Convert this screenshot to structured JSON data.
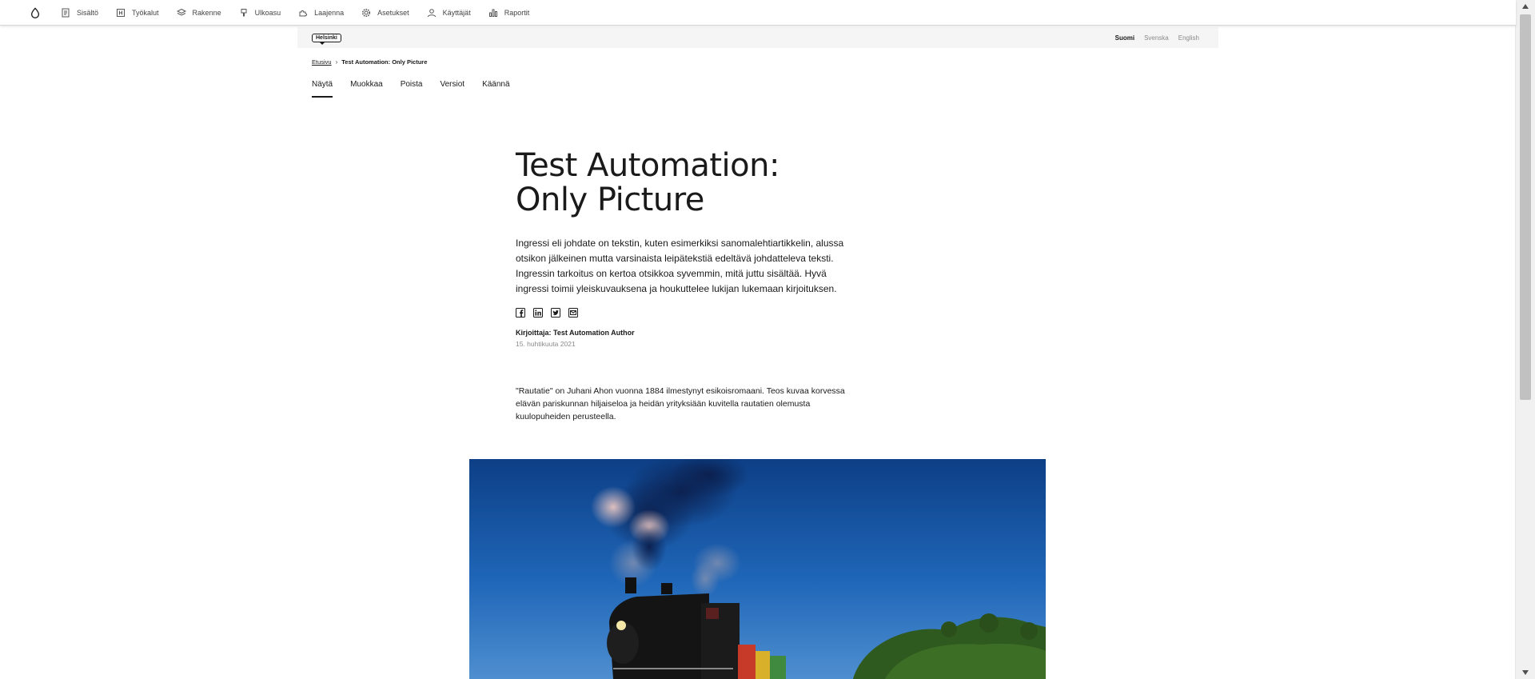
{
  "toolbar": {
    "home_icon": "drop-icon",
    "items": [
      {
        "label": "Sisältö",
        "icon": "document-icon"
      },
      {
        "label": "Työkalut",
        "icon": "tools-icon"
      },
      {
        "label": "Rakenne",
        "icon": "layers-icon"
      },
      {
        "label": "Ulkoasu",
        "icon": "brush-icon"
      },
      {
        "label": "Laajenna",
        "icon": "puzzle-icon"
      },
      {
        "label": "Asetukset",
        "icon": "gear-icon"
      },
      {
        "label": "Käyttäjät",
        "icon": "user-icon"
      },
      {
        "label": "Raportit",
        "icon": "bar-chart-icon"
      }
    ]
  },
  "header": {
    "logo": "Helsinki",
    "languages": [
      {
        "label": "Suomi",
        "active": true
      },
      {
        "label": "Svenska",
        "active": false
      },
      {
        "label": "English",
        "active": false
      }
    ]
  },
  "breadcrumb": {
    "home": "Etusivu",
    "current": "Test Automation: Only Picture"
  },
  "tabs": [
    {
      "label": "Näytä",
      "active": true
    },
    {
      "label": "Muokkaa",
      "active": false
    },
    {
      "label": "Poista",
      "active": false
    },
    {
      "label": "Versiot",
      "active": false
    },
    {
      "label": "Käännä",
      "active": false
    }
  ],
  "article": {
    "title": "Test Automation: Only Picture",
    "lead": "Ingressi eli johdate on tekstin, kuten esimerkiksi sanomalehtiartikkelin, alussa otsikon jälkeinen mutta varsinaista leipätekstiä edeltävä johdatteleva teksti. Ingressin tarkoitus on kertoa otsikkoa syvemmin, mitä juttu sisältää. Hyvä ingressi toimii yleiskuvauksena ja houkuttelee lukijan lukemaan kirjoituksen.",
    "share_icons": [
      "facebook-icon",
      "linkedin-icon",
      "twitter-icon",
      "email-icon"
    ],
    "author": "Kirjoittaja: Test Automation Author",
    "date": "15. huhtikuuta 2021",
    "body": "\"Rautatie\" on Juhani Ahon vuonna 1884 ilmestynyt esikoisromaani. Teos kuvaa korvessa elävän pariskunnan hiljaiseloa ja heidän yrityksiään kuvitella rautatien olemusta kuulopuheiden perusteella.",
    "image": "steam-locomotive-photo"
  },
  "colors": {
    "text": "#1a1a1a",
    "muted": "#8a8a8a",
    "header_bg": "#f5f5f5",
    "sky": "#1f66b8"
  }
}
